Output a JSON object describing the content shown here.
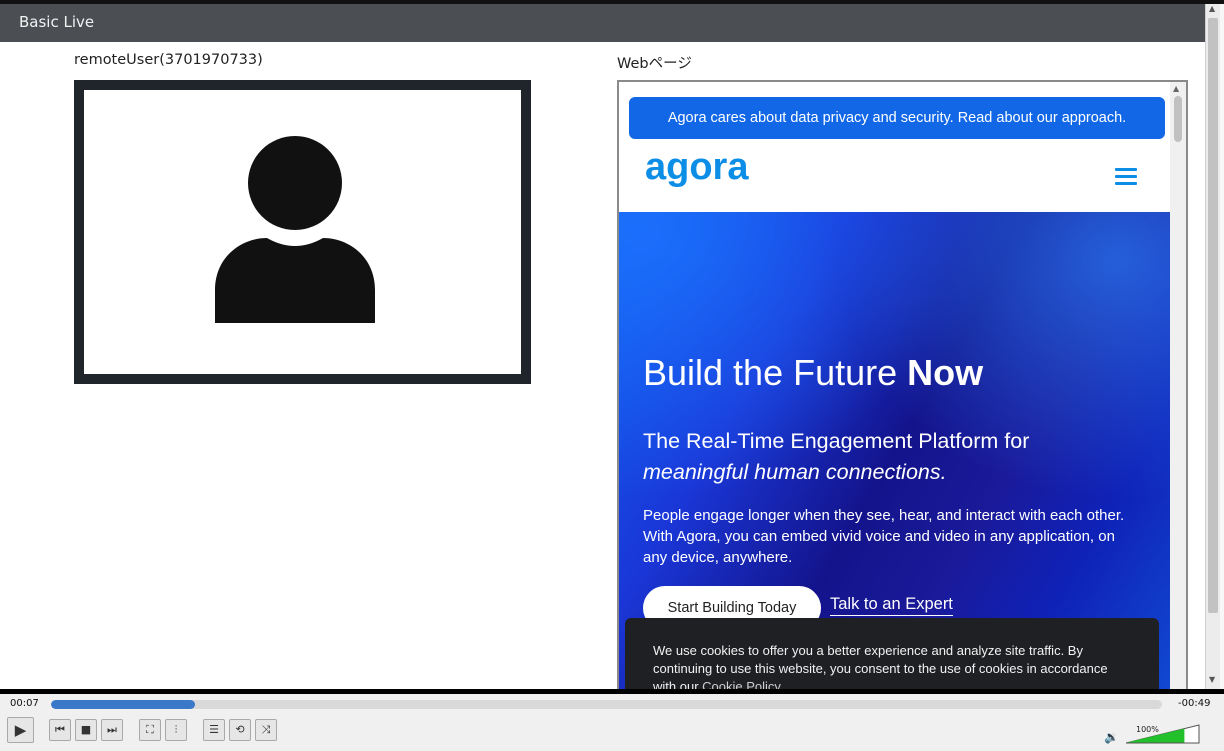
{
  "window": {
    "title": "Basic Live"
  },
  "remote": {
    "label": "remoteUser(3701970733)"
  },
  "web": {
    "label": "Webページ",
    "privacy_banner": "Agora cares about data privacy and security. Read about our approach.",
    "logo_text": "agora",
    "hero": {
      "title_regular": "Build the Future ",
      "title_bold": "Now",
      "subtitle_line1": "The Real-Time Engagement Platform for",
      "subtitle_line2": "meaningful human connections.",
      "body": "People engage longer when they see, hear, and interact with each other. With Agora, you can embed vivid voice and video in any application, on any device, anywhere.",
      "cta_primary": "Start Building Today",
      "cta_secondary": "Talk to an Expert"
    },
    "cookie": {
      "text": "We use cookies to offer you a better experience and analyze site traffic. By continuing to use this website, you consent to the use of cookies in accordance with our ",
      "policy_link": "Cookie Policy."
    }
  },
  "player": {
    "elapsed": "00:07",
    "remaining": "-00:49",
    "progress_fraction": 0.13,
    "volume_label": "100%",
    "volume_fraction": 0.8
  },
  "colors": {
    "accent": "#1167e6",
    "logo": "#0c8ee6",
    "progress": "#3a78c9",
    "volume": "#22c02a"
  },
  "icons": {
    "avatar": "person-silhouette-icon",
    "menu": "hamburger-menu-icon",
    "play": "play-icon",
    "prev": "skip-previous-icon",
    "stop": "stop-icon",
    "next": "skip-next-icon",
    "fullscreen": "fullscreen-icon",
    "equalizer": "equalizer-icon",
    "playlist": "playlist-icon",
    "loop": "loop-icon",
    "shuffle": "shuffle-icon",
    "speaker": "speaker-icon"
  }
}
